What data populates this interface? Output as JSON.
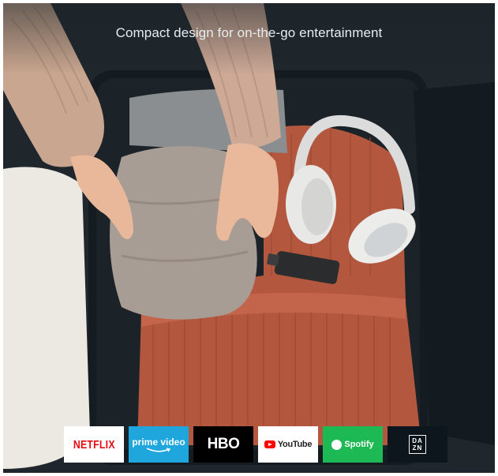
{
  "caption": "Compact design for on-the-go entertainment",
  "apps": [
    {
      "label": "NETFLIX"
    },
    {
      "label": "prime video"
    },
    {
      "label": "HBO"
    },
    {
      "label": "YouTube"
    },
    {
      "label": "Spotify"
    },
    {
      "label_top": "DA",
      "label_bottom": "ZN"
    }
  ]
}
